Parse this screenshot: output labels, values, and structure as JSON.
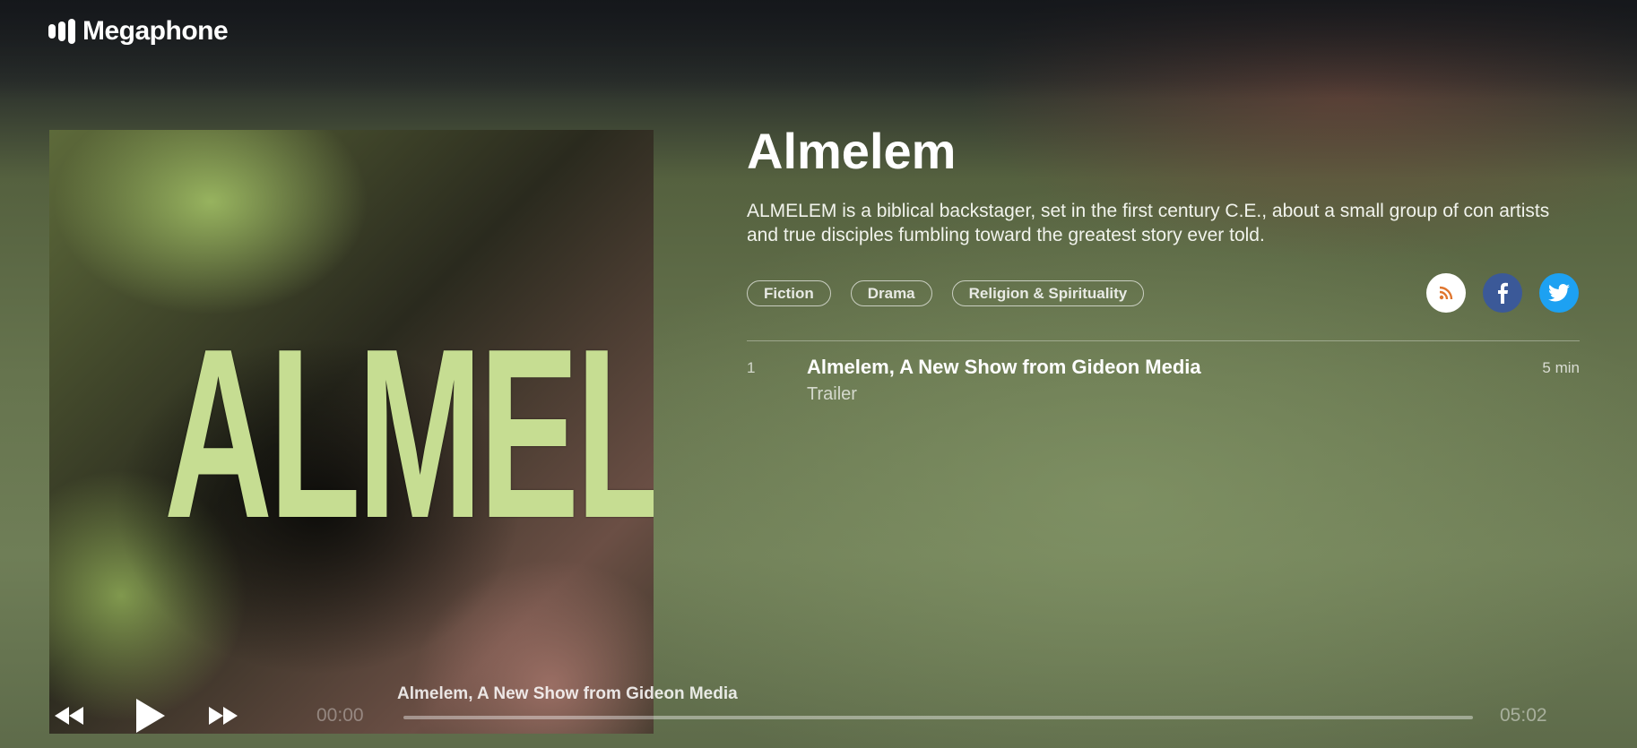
{
  "brand": {
    "name": "Megaphone",
    "icon": "megaphone-bars-icon"
  },
  "podcast": {
    "cover_text": "ALMELEM",
    "title": "Almelem",
    "description": "ALMELEM is a biblical backstager, set in the first century C.E., about a small group of con artists and true disciples fumbling toward the greatest story ever told.",
    "tags": [
      "Fiction",
      "Drama",
      "Religion & Spirituality"
    ]
  },
  "social": [
    {
      "name": "rss",
      "icon": "rss-icon",
      "color": "#e0762f"
    },
    {
      "name": "facebook",
      "icon": "facebook-icon",
      "color": "#3b5998"
    },
    {
      "name": "twitter",
      "icon": "twitter-icon",
      "color": "#1da1f2"
    }
  ],
  "episodes": [
    {
      "number": "1",
      "title": "Almelem, A New Show from Gideon Media",
      "subtitle": "Trailer",
      "duration": "5 min"
    }
  ],
  "player": {
    "now_playing": "Almelem, A New Show from Gideon Media",
    "current_time": "00:00",
    "total_time": "05:02",
    "progress": 0
  }
}
